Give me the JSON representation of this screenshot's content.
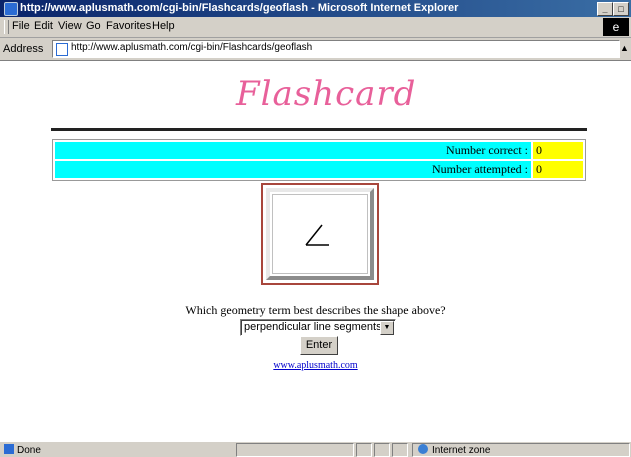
{
  "window": {
    "title": "http://www.aplusmath.com/cgi-bin/Flashcards/geoflash - Microsoft Internet Explorer"
  },
  "menu": {
    "items": [
      {
        "label": "File"
      },
      {
        "label": "Edit"
      },
      {
        "label": "View"
      },
      {
        "label": "Go"
      },
      {
        "label": "Favorites"
      },
      {
        "label": "Help"
      }
    ]
  },
  "address": {
    "label": "Address",
    "url": "http://www.aplusmath.com/cgi-bin/Flashcards/geoflash"
  },
  "page": {
    "logo": "Flashcard",
    "scores": [
      {
        "label": "Number correct :",
        "value": "0"
      },
      {
        "label": "Number attempted :",
        "value": "0"
      }
    ],
    "question": "Which geometry term best describes the shape above?",
    "answer_selected": "perpendicular line segments",
    "enter_label": "Enter",
    "link_text": "www.aplusmath.com"
  },
  "status": {
    "text": "Done",
    "zone": "Internet zone"
  },
  "colors": {
    "logo": "#e8609a",
    "score_label_bg": "#00ffff",
    "score_value_bg": "#ffff00",
    "card_border": "#a8463c",
    "link": "#0000cc"
  }
}
